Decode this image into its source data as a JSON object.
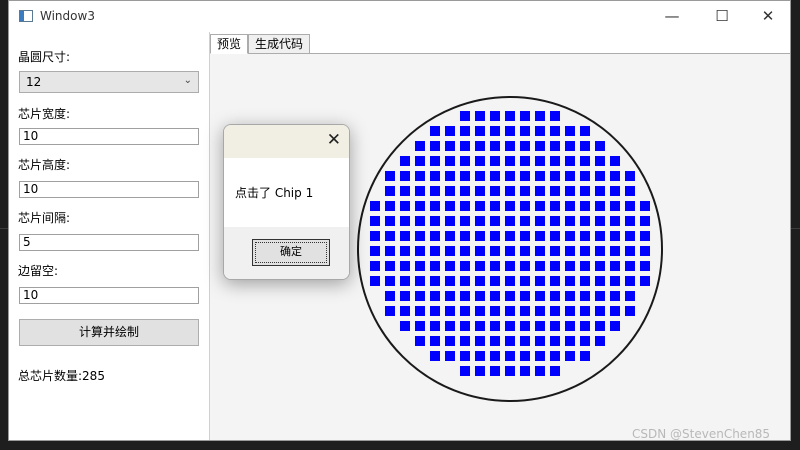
{
  "window": {
    "title": "Window3",
    "minimize_glyph": "—",
    "maximize_glyph": "☐",
    "close_glyph": "✕"
  },
  "form": {
    "wafer_size_label": "晶圆尺寸:",
    "wafer_size_value": "12",
    "chip_width_label": "芯片宽度:",
    "chip_width_value": "10",
    "chip_height_label": "芯片高度:",
    "chip_height_value": "10",
    "chip_spacing_label": "芯片间隔:",
    "chip_spacing_value": "5",
    "margin_label": "边留空:",
    "margin_value": "10",
    "calc_button": "计算并绘制",
    "total_chips_text": "总芯片数量:285"
  },
  "tabs": [
    {
      "label": "预览",
      "active": true
    },
    {
      "label": "生成代码",
      "active": false
    }
  ],
  "wafer": {
    "chip_color": "#0000ff",
    "outline_color": "#1a1a1a",
    "background": "#f4f4f4",
    "row_counts": [
      7,
      11,
      13,
      15,
      17,
      17,
      19,
      19,
      19,
      19,
      19,
      19,
      17,
      17,
      15,
      13,
      11,
      7
    ]
  },
  "dialog": {
    "message": "点击了 Chip 1",
    "ok_label": "确定",
    "close_glyph": "✕"
  },
  "watermark": "CSDN @StevenChen85"
}
